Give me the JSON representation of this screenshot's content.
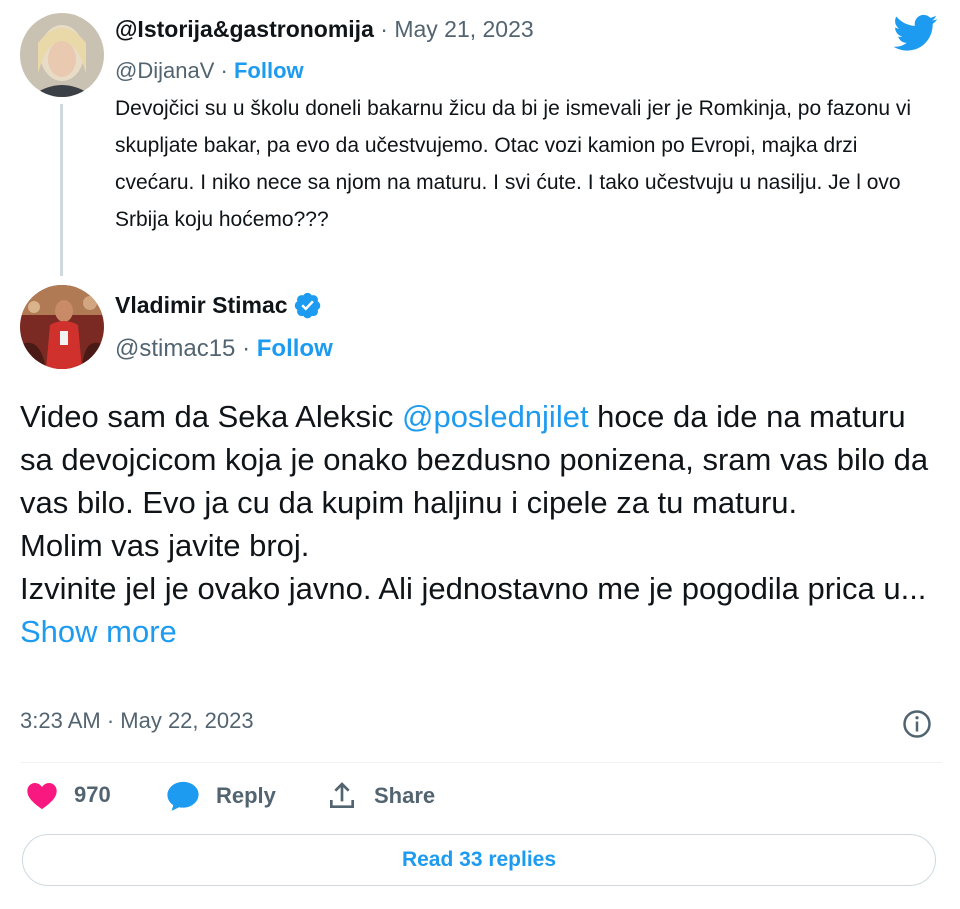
{
  "quoted_tweet": {
    "display_name": "@Istorija&gastronomija",
    "date": "· May 21, 2023",
    "handle": "@DijanaV",
    "separator": "·",
    "follow_label": "Follow",
    "text": "Devojčici su u školu doneli bakarnu žicu da bi je ismevali jer je Romkinja, po fazonu vi skupljate bakar, pa evo da učestvujemo. Otac vozi kamion po Evropi, majka drzi cvećaru. I niko nece sa njom na maturu. I svi ćute. I tako učestvuju u nasilju. Je l ovo Srbija koju hoćemo???"
  },
  "main_tweet": {
    "display_name": "Vladimir Stimac",
    "handle": "@stimac15",
    "separator": "·",
    "follow_label": "Follow",
    "text_before_mention": "Video sam da Seka Aleksic ",
    "mention": "@poslednjilet",
    "text_after_mention": " hoce da ide na maturu sa devojcicom koja je onako bezdusno ponizena, sram vas bilo da vas bilo. Evo ja cu da kupim haljinu i cipele za tu maturu.",
    "line_2": "Molim vas javite broj.",
    "line_3": "Izvinite jel je ovako javno. Ali jednostavno me je pogodila prica u...",
    "show_more": "Show more",
    "timestamp": "3:23 AM · May 22, 2023"
  },
  "actions": {
    "likes_count": "970",
    "reply_label": "Reply",
    "share_label": "Share"
  },
  "read_replies_label": "Read 33 replies",
  "colors": {
    "twitter_blue": "#1d9bf0",
    "like_pink": "#f91880",
    "text_primary": "#0f1419",
    "text_muted": "#536471"
  },
  "icons": [
    "twitter-bird-icon",
    "verified-badge-icon",
    "info-icon",
    "heart-icon",
    "reply-bubble-icon",
    "share-icon"
  ]
}
